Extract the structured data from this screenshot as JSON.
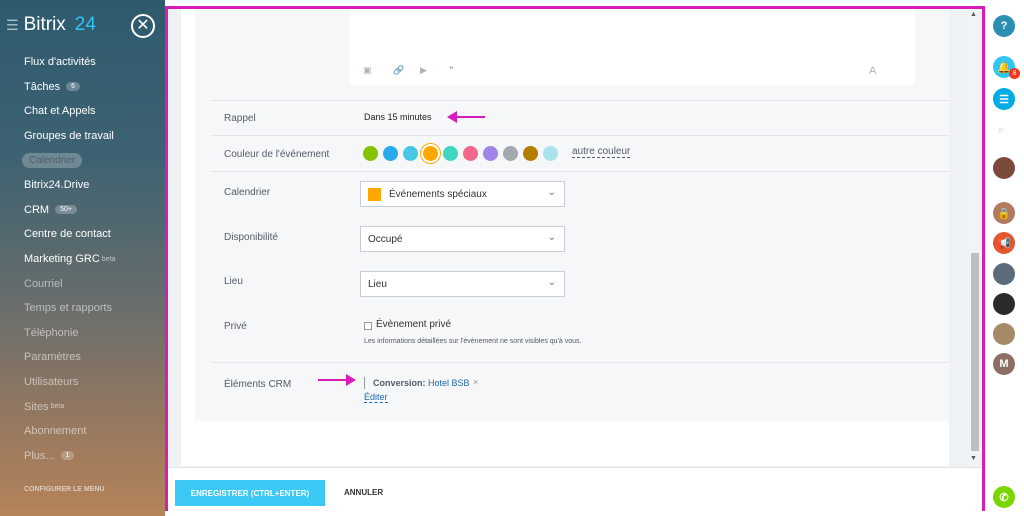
{
  "sidebar": {
    "brand": "Bitrix",
    "brand_num": "24",
    "items": [
      {
        "label": "Flux d'activités"
      },
      {
        "label": "Tâches",
        "badge": "6"
      },
      {
        "label": "Chat et Appels"
      },
      {
        "label": "Groupes de travail"
      },
      {
        "label": "Calendrier"
      },
      {
        "label": "Bitrix24.Drive"
      },
      {
        "label": "CRM",
        "badge": "50+"
      },
      {
        "label": "Centre de contact"
      },
      {
        "label": "Marketing GRC",
        "sup": "beta"
      },
      {
        "label": "Courriel"
      },
      {
        "label": "Temps et rapports"
      },
      {
        "label": "Téléphonie"
      },
      {
        "label": "Paramètres"
      },
      {
        "label": "Utilisateurs"
      },
      {
        "label": "Sites",
        "sup": "beta"
      },
      {
        "label": "Abonnement"
      },
      {
        "label": "Plus...",
        "badge": "1"
      }
    ],
    "configure": "CONFIGURER LE MENU"
  },
  "form": {
    "editor_tools": {
      "font": "A"
    },
    "rappel": {
      "label": "Rappel",
      "value": "Dans 15 minutes"
    },
    "couleur": {
      "label": "Couleur de l'événement",
      "other": "autre couleur",
      "colors": [
        "#86c200",
        "#29aaeb",
        "#47c8e5",
        "#ffa900",
        "#3dd6c1",
        "#f2688d",
        "#9f86e6",
        "#a3a9ae",
        "#b57d00",
        "#abe3ec"
      ]
    },
    "calendrier": {
      "label": "Calendrier",
      "value": "Événements spéciaux"
    },
    "dispo": {
      "label": "Disponibilité",
      "value": "Occupé"
    },
    "lieu": {
      "label": "Lieu",
      "value": "Lieu"
    },
    "prive": {
      "label": "Privé",
      "checkbox": "Évènement privé",
      "hint": "Les informations détaillées sur l'évènement ne sont visibles qu'à vous."
    },
    "crm": {
      "label": "Éléments CRM",
      "prefix": "Conversion:",
      "item": "Hotel BSB",
      "edit": "Éditer"
    }
  },
  "footer": {
    "save": "ENREGISTRER (CTRL+ENTER)",
    "cancel": "ANNULER"
  },
  "rightbar": {
    "notif_count": "8",
    "avatar_letter": "M"
  }
}
